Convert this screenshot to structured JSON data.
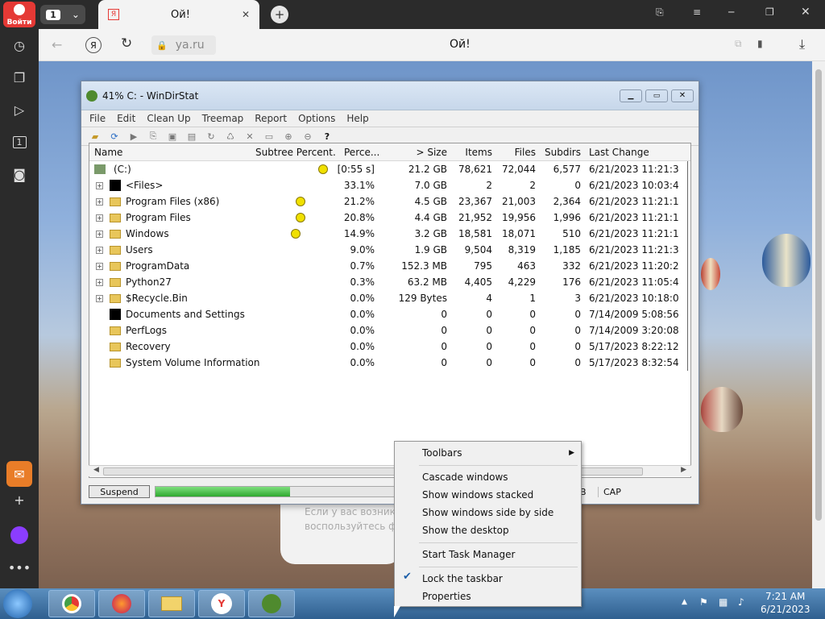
{
  "sidebar": {
    "login_label": "Войти",
    "badge_label": "1",
    "icons": [
      "history-icon",
      "collections-icon",
      "play-icon",
      "number-icon",
      "camera-icon",
      "mail-icon",
      "add-icon",
      "alice-icon",
      "more-icon"
    ]
  },
  "tab": {
    "count": "1",
    "title": "Ой!"
  },
  "addressbar": {
    "url": "ya.ru",
    "page_title": "Ой!"
  },
  "page": {
    "text_line1": "Если у вас возникли",
    "text_line2": "воспользуйтесь фор"
  },
  "windirstat": {
    "title": "41% C: - WinDirStat",
    "menu": [
      "File",
      "Edit",
      "Clean Up",
      "Treemap",
      "Report",
      "Options",
      "Help"
    ],
    "columns": [
      "Name",
      "Subtree Percent...",
      "Perce...",
      "> Size",
      "Items",
      "Files",
      "Subdirs",
      "Last Change"
    ],
    "rows": [
      {
        "name": "(C:)",
        "perc": "[0:55 s]",
        "size": "21.2 GB",
        "items": "78,621",
        "files": "72,044",
        "subdirs": "6,577",
        "last": "6/21/2023  11:21:3..."
      },
      {
        "name": "<Files>",
        "perc": "33.1%",
        "size": "7.0 GB",
        "items": "2",
        "files": "2",
        "subdirs": "0",
        "last": "6/21/2023  10:03:4..."
      },
      {
        "name": "Program Files (x86)",
        "perc": "21.2%",
        "size": "4.5 GB",
        "items": "23,367",
        "files": "21,003",
        "subdirs": "2,364",
        "last": "6/21/2023  11:21:1..."
      },
      {
        "name": "Program Files",
        "perc": "20.8%",
        "size": "4.4 GB",
        "items": "21,952",
        "files": "19,956",
        "subdirs": "1,996",
        "last": "6/21/2023  11:21:1..."
      },
      {
        "name": "Windows",
        "perc": "14.9%",
        "size": "3.2 GB",
        "items": "18,581",
        "files": "18,071",
        "subdirs": "510",
        "last": "6/21/2023  11:21:1..."
      },
      {
        "name": "Users",
        "perc": "9.0%",
        "size": "1.9 GB",
        "items": "9,504",
        "files": "8,319",
        "subdirs": "1,185",
        "last": "6/21/2023  11:21:3..."
      },
      {
        "name": "ProgramData",
        "perc": "0.7%",
        "size": "152.3 MB",
        "items": "795",
        "files": "463",
        "subdirs": "332",
        "last": "6/21/2023  11:20:2..."
      },
      {
        "name": "Python27",
        "perc": "0.3%",
        "size": "63.2 MB",
        "items": "4,405",
        "files": "4,229",
        "subdirs": "176",
        "last": "6/21/2023  11:05:4..."
      },
      {
        "name": "$Recycle.Bin",
        "perc": "0.0%",
        "size": "129 Bytes",
        "items": "4",
        "files": "1",
        "subdirs": "3",
        "last": "6/21/2023  10:18:0..."
      },
      {
        "name": "Documents and Settings",
        "perc": "0.0%",
        "size": "0",
        "items": "0",
        "files": "0",
        "subdirs": "0",
        "last": "7/14/2009  5:08:56 ..."
      },
      {
        "name": "PerfLogs",
        "perc": "0.0%",
        "size": "0",
        "items": "0",
        "files": "0",
        "subdirs": "0",
        "last": "7/14/2009  3:20:08 ..."
      },
      {
        "name": "Recovery",
        "perc": "0.0%",
        "size": "0",
        "items": "0",
        "files": "0",
        "subdirs": "0",
        "last": "5/17/2023  8:22:12 ..."
      },
      {
        "name": "System Volume Information",
        "perc": "0.0%",
        "size": "0",
        "items": "0",
        "files": "0",
        "subdirs": "0",
        "last": "5/17/2023  8:32:54 ..."
      }
    ],
    "suspend_label": "Suspend",
    "progress": 0.56,
    "status_b": "B",
    "status_cap": "CAP"
  },
  "context_menu": {
    "items": [
      "Toolbars",
      "Cascade windows",
      "Show windows stacked",
      "Show windows side by side",
      "Show the desktop",
      "Start Task Manager",
      "Lock the taskbar",
      "Properties"
    ],
    "checked": "Lock the taskbar"
  },
  "taskbar": {
    "time": "7:21 AM",
    "date": "6/21/2023"
  },
  "colors": {
    "pacman": "#f0e000",
    "progress": "#3bbf3b"
  }
}
